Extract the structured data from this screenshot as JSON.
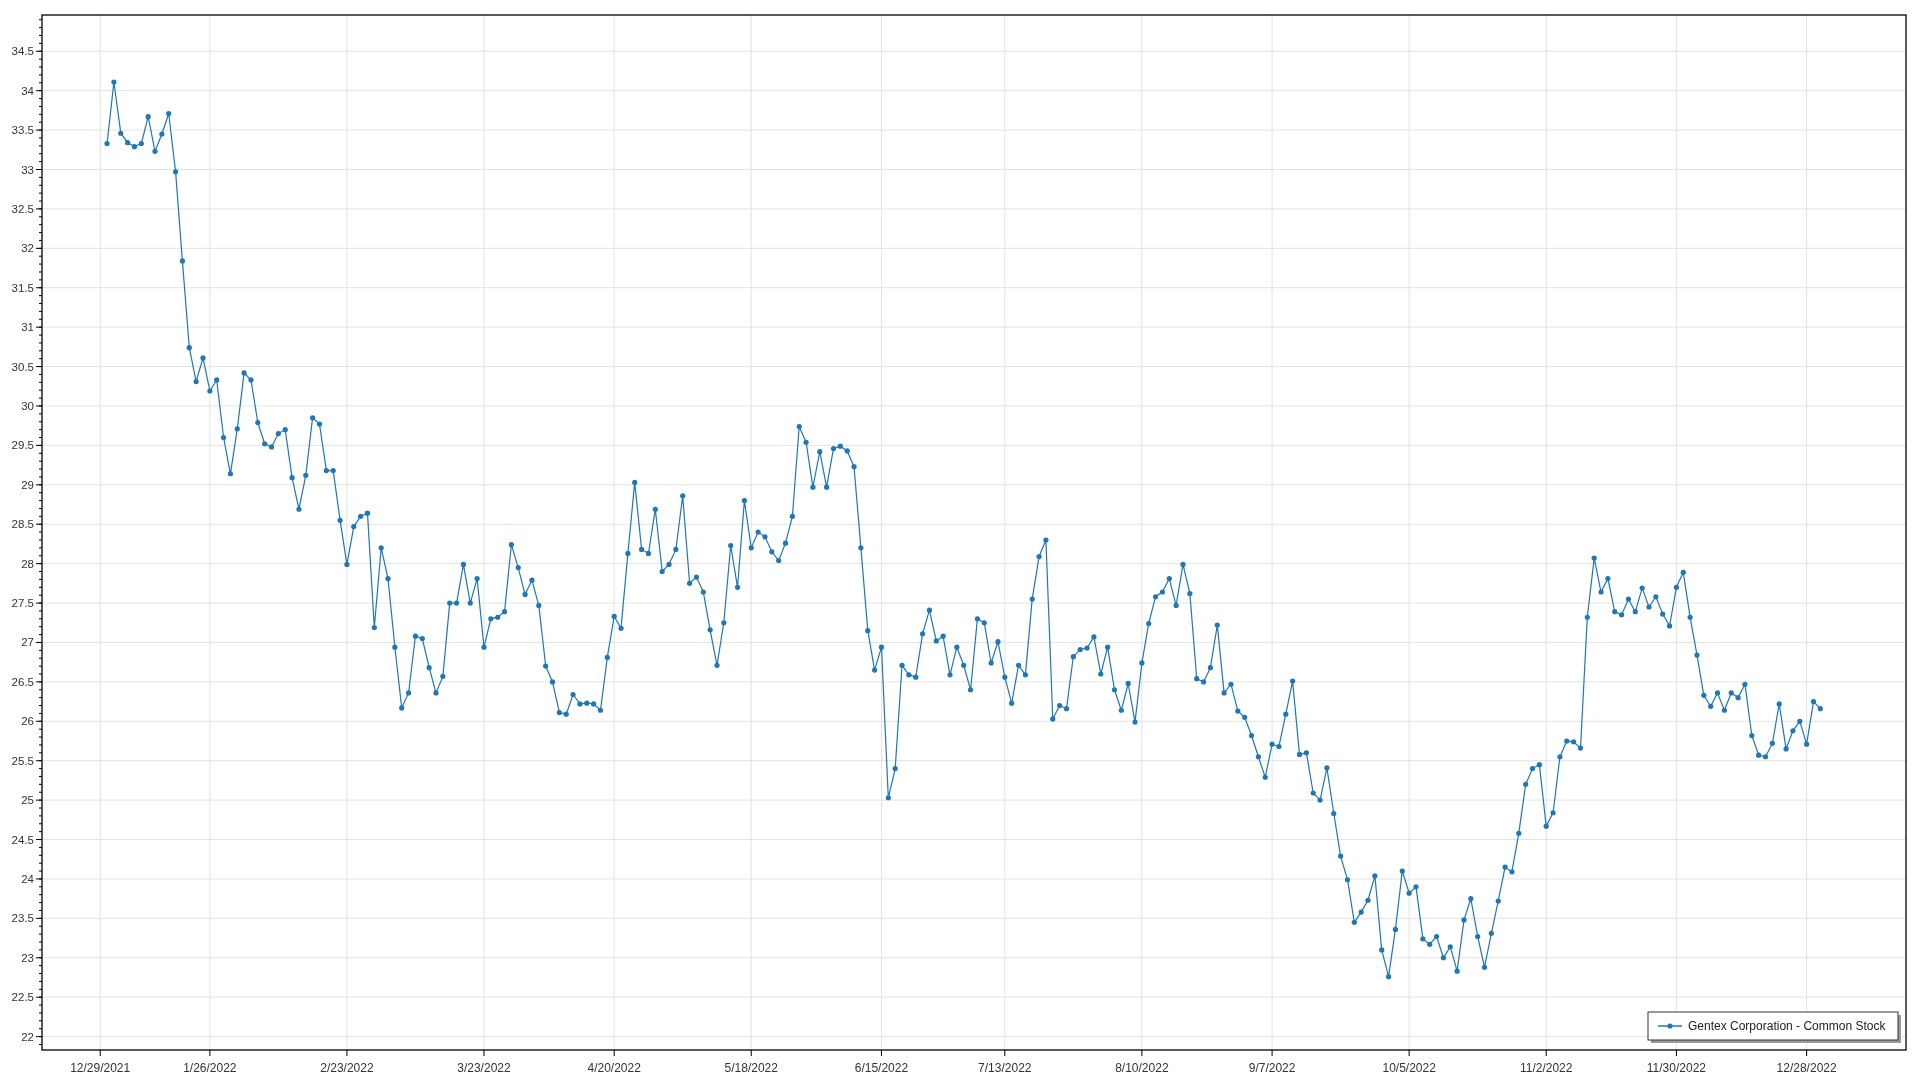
{
  "chart_data": {
    "type": "line",
    "grid": true,
    "ylim": [
      21.83,
      34.96
    ],
    "categories": [
      "12/29/2021",
      null,
      null,
      null,
      null,
      null,
      null,
      null,
      null,
      null,
      null,
      null,
      null,
      null,
      null,
      null,
      "1/26/2022",
      null,
      null,
      null,
      null,
      null,
      null,
      null,
      null,
      null,
      null,
      null,
      null,
      null,
      null,
      null,
      null,
      null,
      null,
      null,
      "2/23/2022",
      null,
      null,
      null,
      null,
      null,
      null,
      null,
      null,
      null,
      null,
      null,
      null,
      null,
      null,
      null,
      null,
      null,
      null,
      null,
      "3/23/2022",
      null,
      null,
      null,
      null,
      null,
      null,
      null,
      null,
      null,
      null,
      null,
      null,
      null,
      null,
      null,
      null,
      null,
      null,
      "4/20/2022",
      null,
      null,
      null,
      null,
      null,
      null,
      null,
      null,
      null,
      null,
      null,
      null,
      null,
      null,
      null,
      null,
      null,
      null,
      null,
      "5/18/2022",
      null,
      null,
      null,
      null,
      null,
      null,
      null,
      null,
      null,
      null,
      null,
      null,
      null,
      null,
      null,
      null,
      null,
      null,
      "6/15/2022",
      null,
      null,
      null,
      null,
      null,
      null,
      null,
      null,
      null,
      null,
      null,
      null,
      null,
      null,
      null,
      null,
      null,
      "7/13/2022",
      null,
      null,
      null,
      null,
      null,
      null,
      null,
      null,
      null,
      null,
      null,
      null,
      null,
      null,
      null,
      null,
      null,
      null,
      null,
      "8/10/2022",
      null,
      null,
      null,
      null,
      null,
      null,
      null,
      null,
      null,
      null,
      null,
      null,
      null,
      null,
      null,
      null,
      null,
      null,
      "9/7/2022",
      null,
      null,
      null,
      null,
      null,
      null,
      null,
      null,
      null,
      null,
      null,
      null,
      null,
      null,
      null,
      null,
      null,
      null,
      null,
      "10/5/2022",
      null,
      null,
      null,
      null,
      null,
      null,
      null,
      null,
      null,
      null,
      null,
      null,
      null,
      null,
      null,
      null,
      null,
      null,
      null,
      "11/2/2022",
      null,
      null,
      null,
      null,
      null,
      null,
      null,
      null,
      null,
      null,
      null,
      null,
      null,
      null,
      null,
      null,
      null,
      null,
      "11/30/2022",
      null,
      null,
      null,
      null,
      null,
      null,
      null,
      null,
      null,
      null,
      null,
      null,
      null,
      null,
      null,
      null,
      null,
      null,
      "12/28/2022",
      null,
      null
    ],
    "yticks": [
      22,
      22.5,
      23,
      23.5,
      24,
      24.5,
      25,
      25.5,
      26,
      26.5,
      27,
      27.5,
      28,
      28.5,
      29,
      29.5,
      30,
      30.5,
      31,
      31.5,
      32,
      32.5,
      33,
      33.5,
      34,
      34.5
    ],
    "series": [
      {
        "name": "Gentex Corporation - Common Stock",
        "color": "#1f77b4",
        "values": [
          null,
          33.33,
          34.11,
          33.46,
          33.34,
          33.29,
          33.33,
          33.67,
          33.23,
          33.45,
          33.71,
          32.97,
          31.84,
          30.74,
          30.31,
          30.61,
          30.19,
          30.33,
          29.6,
          29.14,
          29.71,
          30.42,
          30.33,
          29.79,
          29.52,
          29.48,
          29.65,
          29.7,
          29.09,
          28.69,
          29.12,
          29.85,
          29.77,
          29.18,
          29.18,
          28.55,
          27.99,
          28.47,
          28.6,
          28.64,
          27.19,
          28.2,
          27.81,
          26.94,
          26.17,
          26.36,
          27.08,
          27.05,
          26.68,
          26.36,
          26.57,
          27.5,
          27.5,
          27.99,
          27.5,
          27.81,
          26.94,
          27.3,
          27.32,
          27.39,
          28.24,
          27.95,
          27.61,
          27.79,
          27.47,
          26.7,
          26.5,
          26.11,
          26.09,
          26.34,
          26.22,
          26.23,
          26.22,
          26.14,
          26.81,
          27.33,
          27.18,
          28.13,
          29.03,
          28.18,
          28.13,
          28.69,
          27.9,
          27.99,
          28.18,
          28.86,
          27.75,
          27.83,
          27.64,
          27.16,
          26.71,
          27.25,
          28.23,
          27.7,
          28.8,
          28.2,
          28.4,
          28.34,
          28.15,
          28.04,
          28.26,
          28.6,
          29.74,
          29.54,
          28.97,
          29.42,
          28.97,
          29.46,
          29.49,
          29.43,
          29.23,
          28.2,
          27.15,
          26.65,
          26.94,
          25.03,
          25.4,
          26.71,
          26.59,
          26.56,
          27.11,
          27.41,
          27.02,
          27.08,
          26.59,
          26.94,
          26.71,
          26.4,
          27.3,
          27.25,
          26.74,
          27.01,
          26.56,
          26.23,
          26.71,
          26.59,
          27.55,
          28.09,
          28.3,
          26.03,
          26.2,
          26.16,
          26.82,
          26.91,
          26.93,
          27.07,
          26.6,
          26.94,
          26.4,
          26.14,
          26.48,
          25.99,
          26.74,
          27.24,
          27.58,
          27.64,
          27.81,
          27.47,
          27.99,
          27.62,
          26.54,
          26.5,
          26.68,
          27.22,
          26.36,
          26.47,
          26.13,
          26.05,
          25.82,
          25.55,
          25.29,
          25.71,
          25.68,
          26.09,
          26.51,
          25.58,
          25.6,
          25.09,
          25,
          25.41,
          24.83,
          24.29,
          23.99,
          23.45,
          23.58,
          23.73,
          24.04,
          23.1,
          22.76,
          23.36,
          24.1,
          23.82,
          23.9,
          23.24,
          23.17,
          23.27,
          23,
          23.14,
          22.83,
          23.48,
          23.75,
          23.27,
          22.88,
          23.31,
          23.72,
          24.15,
          24.09,
          24.58,
          25.2,
          25.4,
          25.45,
          24.67,
          24.84,
          25.55,
          25.75,
          25.74,
          25.66,
          27.32,
          28.07,
          27.64,
          27.81,
          27.39,
          27.35,
          27.55,
          27.39,
          27.69,
          27.45,
          27.58,
          27.36,
          27.21,
          27.7,
          27.89,
          27.32,
          26.84,
          26.33,
          26.19,
          26.36,
          26.14,
          26.36,
          26.3,
          26.47,
          25.82,
          25.57,
          25.55,
          25.72,
          26.22,
          25.65,
          25.88,
          26,
          25.71,
          26.25,
          26.16
        ]
      }
    ]
  }
}
